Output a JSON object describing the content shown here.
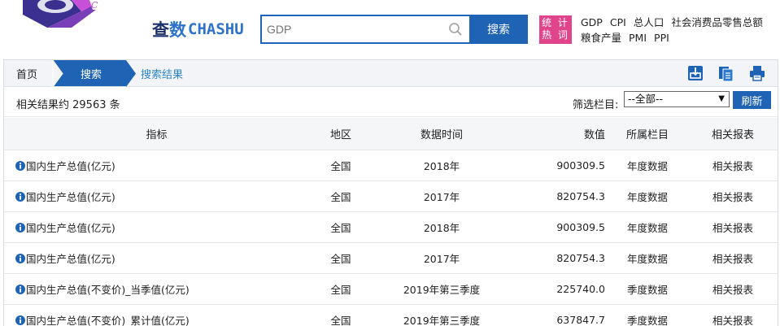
{
  "brand": {
    "cn_part1": "查",
    "cn_part2": "数",
    "en": "CHASHU"
  },
  "search": {
    "value": "",
    "placeholder": "GDP",
    "button_label": "搜索"
  },
  "stat_badge": {
    "line1": "统 计",
    "line2": "热 词"
  },
  "hot_terms": [
    "GDP",
    "CPI",
    "总人口",
    "社会消费品零售总额",
    "粮食产量",
    "PMI",
    "PPI"
  ],
  "breadcrumb": {
    "home": "首页",
    "search": "搜索",
    "result": "搜索结果"
  },
  "toolbar_icons": [
    "export-icon",
    "copy-icon",
    "print-icon"
  ],
  "filter": {
    "result_count": "相关结果约 29563 条",
    "label": "筛选栏目:",
    "selected": "--全部--",
    "refresh_label": "刷新"
  },
  "table": {
    "headers": [
      "指标",
      "地区",
      "数据时间",
      "数值",
      "所属栏目",
      "相关报表"
    ],
    "rows": [
      [
        "国内生产总值(亿元)",
        "全国",
        "2018年",
        "900309.5",
        "年度数据",
        "相关报表"
      ],
      [
        "国内生产总值(亿元)",
        "全国",
        "2017年",
        "820754.3",
        "年度数据",
        "相关报表"
      ],
      [
        "国内生产总值(亿元)",
        "全国",
        "2018年",
        "900309.5",
        "年度数据",
        "相关报表"
      ],
      [
        "国内生产总值(亿元)",
        "全国",
        "2017年",
        "820754.3",
        "年度数据",
        "相关报表"
      ],
      [
        "国内生产总值(不变价)_当季值(亿元)",
        "全国",
        "2019年第三季度",
        "225740.0",
        "季度数据",
        "相关报表"
      ],
      [
        "国内生产总值(不变价)_累计值(亿元)",
        "全国",
        "2019年第三季度",
        "637847.7",
        "季度数据",
        "相关报表"
      ]
    ]
  },
  "colors": {
    "primary": "#1f63b5",
    "badge": "#e0458b",
    "link": "#2d84c6"
  }
}
